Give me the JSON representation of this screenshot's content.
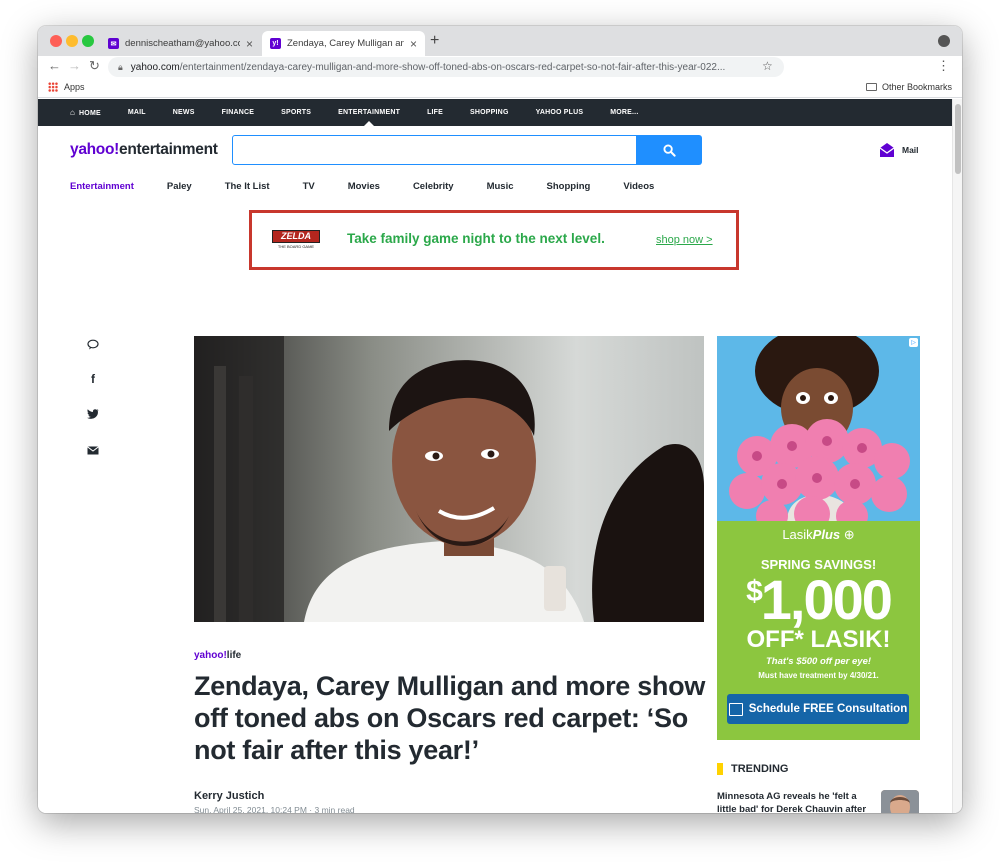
{
  "browser": {
    "tabs": [
      {
        "title": "dennischeatham@yahoo.com",
        "close": "×"
      },
      {
        "title": "Zendaya, Carey Mulligan and m",
        "close": "×"
      }
    ],
    "new_tab": "+",
    "url_domain": "yahoo.com",
    "url_path": "/entertainment/zendaya-carey-mulligan-and-more-show-off-toned-abs-on-oscars-red-carpet-so-not-fair-after-this-year-022...",
    "bookmarks": {
      "apps": "Apps",
      "other": "Other Bookmarks"
    }
  },
  "yahoo_nav": [
    {
      "label": "HOME"
    },
    {
      "label": "MAIL"
    },
    {
      "label": "NEWS"
    },
    {
      "label": "FINANCE"
    },
    {
      "label": "SPORTS"
    },
    {
      "label": "ENTERTAINMENT"
    },
    {
      "label": "LIFE"
    },
    {
      "label": "SHOPPING"
    },
    {
      "label": "YAHOO PLUS"
    },
    {
      "label": "MORE..."
    }
  ],
  "header": {
    "logo_yahoo": "yahoo",
    "logo_bang": "!",
    "logo_section": "entertainment",
    "search_placeholder": "",
    "mail_label": "Mail"
  },
  "subnav": [
    {
      "label": "Entertainment"
    },
    {
      "label": "Paley"
    },
    {
      "label": "The It List"
    },
    {
      "label": "TV"
    },
    {
      "label": "Movies"
    },
    {
      "label": "Celebrity"
    },
    {
      "label": "Music"
    },
    {
      "label": "Shopping"
    },
    {
      "label": "Videos"
    }
  ],
  "top_ad": {
    "logo_line1": "ZELDA",
    "logo_line2": "THE BOARD GAME",
    "text": "Take family game night to the next level.",
    "link": "shop now >"
  },
  "article": {
    "source_yahoo": "yahoo",
    "source_bang": "!",
    "source_section": "life",
    "headline": "Zendaya, Carey Mulligan and more show off toned abs on Oscars red carpet: ‘So not fair after this year!’",
    "author": "Kerry Justich",
    "date": "Sun, April 25, 2021, 10:24 PM · 3 min read"
  },
  "side_ad": {
    "brand_a": "Lasik",
    "brand_b": "Plus",
    "headline": "SPRING SAVINGS!",
    "amount_sign": "$",
    "amount": "1,000",
    "off_line": "OFF* LASIK!",
    "sub1": "That's $500 off per eye!",
    "sub2": "Must have treatment by 4/30/21.",
    "cta": "Schedule FREE Consultation"
  },
  "trending": {
    "heading": "TRENDING",
    "item": "Minnesota AG reveals he 'felt a little bad' for Derek Chauvin after guilty verdict: 'He's a human being'"
  }
}
